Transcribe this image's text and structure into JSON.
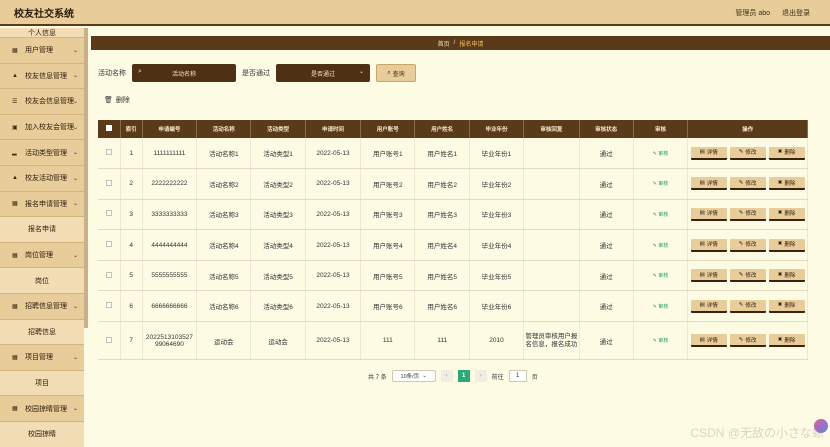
{
  "app": {
    "title": "校友社交系统"
  },
  "user": {
    "label": "管理员 abo",
    "logout": "退出登录"
  },
  "sidebar": {
    "items": [
      {
        "kind": "sub",
        "label": "个人信息"
      },
      {
        "kind": "menu",
        "icon": "grid-icon",
        "label": "用户管理"
      },
      {
        "kind": "menu",
        "icon": "user-icon",
        "label": "校友信息管理"
      },
      {
        "kind": "menu",
        "icon": "list-icon",
        "label": "校友会信息管理"
      },
      {
        "kind": "menu",
        "icon": "box-icon",
        "label": "加入校友会管理"
      },
      {
        "kind": "menu",
        "icon": "chart-icon",
        "label": "活动类型管理"
      },
      {
        "kind": "menu",
        "icon": "user-icon",
        "label": "校友活动管理"
      },
      {
        "kind": "menu",
        "icon": "grid-icon",
        "label": "报名申请管理"
      },
      {
        "kind": "sub",
        "label": "报名申请"
      },
      {
        "kind": "menu",
        "icon": "grid-icon",
        "label": "岗位管理"
      },
      {
        "kind": "sub",
        "label": "岗位"
      },
      {
        "kind": "menu",
        "icon": "grid-icon",
        "label": "招聘信息管理"
      },
      {
        "kind": "sub",
        "label": "招聘信息"
      },
      {
        "kind": "menu",
        "icon": "grid-icon",
        "label": "项目管理"
      },
      {
        "kind": "sub",
        "label": "项目"
      },
      {
        "kind": "menu",
        "icon": "grid-icon",
        "label": "校园掠睛管理"
      },
      {
        "kind": "sub",
        "label": "校园掠睛"
      }
    ]
  },
  "breadcrumb": {
    "home": "首页",
    "sep": "/",
    "current": "报名申请"
  },
  "search": {
    "activity_label": "活动名称",
    "activity_placeholder": "活动名称",
    "pass_label": "是否通过",
    "pass_placeholder": "是否通过",
    "query_button": "查询"
  },
  "toolbar": {
    "delete_label": "删除"
  },
  "table": {
    "headers": [
      "",
      "索引",
      "申请编号",
      "活动名称",
      "活动类型",
      "申请时间",
      "用户账号",
      "用户姓名",
      "毕业年份",
      "审核回复",
      "审核状态",
      "审核",
      "操作"
    ],
    "audit_label": "审核",
    "actions": {
      "detail": "详情",
      "edit": "修改",
      "delete": "删除"
    },
    "rows": [
      {
        "index": "1",
        "number": "1111111111",
        "activity": "活动名称1",
        "type": "活动类型1",
        "date": "2022-05-13",
        "account": "用户账号1",
        "name": "用户姓名1",
        "year": "毕业年份1",
        "reply": "",
        "status": "通过"
      },
      {
        "index": "2",
        "number": "2222222222",
        "activity": "活动名称2",
        "type": "活动类型2",
        "date": "2022-05-13",
        "account": "用户账号2",
        "name": "用户姓名2",
        "year": "毕业年份2",
        "reply": "",
        "status": "通过"
      },
      {
        "index": "3",
        "number": "3333333333",
        "activity": "活动名称3",
        "type": "活动类型3",
        "date": "2022-05-13",
        "account": "用户账号3",
        "name": "用户姓名3",
        "year": "毕业年份3",
        "reply": "",
        "status": "通过"
      },
      {
        "index": "4",
        "number": "4444444444",
        "activity": "活动名称4",
        "type": "活动类型4",
        "date": "2022-05-13",
        "account": "用户账号4",
        "name": "用户姓名4",
        "year": "毕业年份4",
        "reply": "",
        "status": "通过"
      },
      {
        "index": "5",
        "number": "5555555555",
        "activity": "活动名称5",
        "type": "活动类型5",
        "date": "2022-05-13",
        "account": "用户账号5",
        "name": "用户姓名5",
        "year": "毕业年份5",
        "reply": "",
        "status": "通过"
      },
      {
        "index": "6",
        "number": "6666666666",
        "activity": "活动名称6",
        "type": "活动类型6",
        "date": "2022-05-13",
        "account": "用户账号6",
        "name": "用户姓名6",
        "year": "毕业年份6",
        "reply": "",
        "status": "通过"
      },
      {
        "index": "7",
        "number": "2022513103527 99064690",
        "activity": "运动会",
        "type": "运动会",
        "date": "2022-05-13",
        "account": "111",
        "name": "111",
        "year": "2010",
        "reply": "管理员审核用户报名信息，报名成功",
        "status": "通过"
      }
    ]
  },
  "pagination": {
    "total": "共 7 条",
    "page_size": "10条/页",
    "current_page": "1",
    "goto_label": "前往",
    "goto_value": "1",
    "page_unit": "页"
  },
  "watermark": "CSDN @无敌の小さな蜥",
  "colors": {
    "header": "#5b3a1a",
    "sidebar": "#e8cc9a",
    "accent_green": "#2aa876",
    "background": "#fdfbe4"
  }
}
